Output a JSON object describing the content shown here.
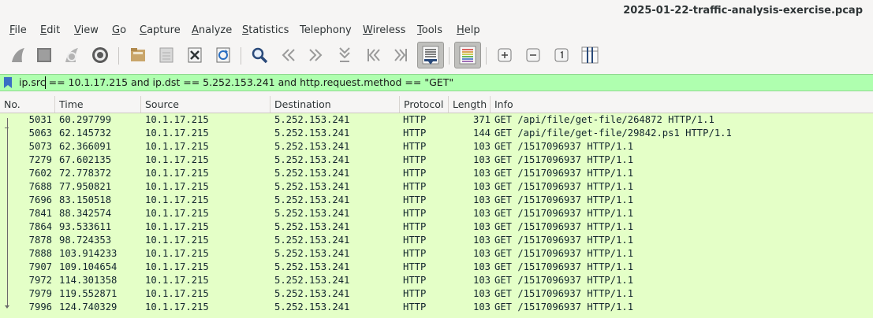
{
  "window": {
    "title": "2025-01-22-traffic-analysis-exercise.pcap"
  },
  "menu": [
    {
      "mn": "F",
      "rest": "ile"
    },
    {
      "mn": "E",
      "rest": "dit"
    },
    {
      "mn": "V",
      "rest": "iew"
    },
    {
      "mn": "G",
      "rest": "o"
    },
    {
      "mn": "C",
      "rest": "apture"
    },
    {
      "mn": "A",
      "rest": "nalyze"
    },
    {
      "mn": "S",
      "rest": "tatistics"
    },
    {
      "mn": "",
      "rest": "Telephony"
    },
    {
      "mn": "W",
      "rest": "ireless"
    },
    {
      "mn": "T",
      "rest": "ools"
    },
    {
      "mn": "H",
      "rest": "elp"
    }
  ],
  "filter": {
    "text": "ip.src == 10.1.17.215 and ip.dst == 5.252.153.241 and http.request.method == \"GET\"",
    "background": "#afffaf"
  },
  "columns": {
    "no": "No.",
    "time": "Time",
    "source": "Source",
    "destination": "Destination",
    "protocol": "Protocol",
    "length": "Length",
    "info": "Info"
  },
  "packets": [
    {
      "no": "5031",
      "time": "60.297799",
      "src": "10.1.17.215",
      "dst": "5.252.153.241",
      "proto": "HTTP",
      "len": "371",
      "info": "GET /api/file/get-file/264872 HTTP/1.1"
    },
    {
      "no": "5063",
      "time": "62.145732",
      "src": "10.1.17.215",
      "dst": "5.252.153.241",
      "proto": "HTTP",
      "len": "144",
      "info": "GET /api/file/get-file/29842.ps1 HTTP/1.1"
    },
    {
      "no": "5073",
      "time": "62.366091",
      "src": "10.1.17.215",
      "dst": "5.252.153.241",
      "proto": "HTTP",
      "len": "103",
      "info": "GET /1517096937 HTTP/1.1"
    },
    {
      "no": "7279",
      "time": "67.602135",
      "src": "10.1.17.215",
      "dst": "5.252.153.241",
      "proto": "HTTP",
      "len": "103",
      "info": "GET /1517096937 HTTP/1.1"
    },
    {
      "no": "7602",
      "time": "72.778372",
      "src": "10.1.17.215",
      "dst": "5.252.153.241",
      "proto": "HTTP",
      "len": "103",
      "info": "GET /1517096937 HTTP/1.1"
    },
    {
      "no": "7688",
      "time": "77.950821",
      "src": "10.1.17.215",
      "dst": "5.252.153.241",
      "proto": "HTTP",
      "len": "103",
      "info": "GET /1517096937 HTTP/1.1"
    },
    {
      "no": "7696",
      "time": "83.150518",
      "src": "10.1.17.215",
      "dst": "5.252.153.241",
      "proto": "HTTP",
      "len": "103",
      "info": "GET /1517096937 HTTP/1.1"
    },
    {
      "no": "7841",
      "time": "88.342574",
      "src": "10.1.17.215",
      "dst": "5.252.153.241",
      "proto": "HTTP",
      "len": "103",
      "info": "GET /1517096937 HTTP/1.1"
    },
    {
      "no": "7864",
      "time": "93.533611",
      "src": "10.1.17.215",
      "dst": "5.252.153.241",
      "proto": "HTTP",
      "len": "103",
      "info": "GET /1517096937 HTTP/1.1"
    },
    {
      "no": "7878",
      "time": "98.724353",
      "src": "10.1.17.215",
      "dst": "5.252.153.241",
      "proto": "HTTP",
      "len": "103",
      "info": "GET /1517096937 HTTP/1.1"
    },
    {
      "no": "7888",
      "time": "103.914233",
      "src": "10.1.17.215",
      "dst": "5.252.153.241",
      "proto": "HTTP",
      "len": "103",
      "info": "GET /1517096937 HTTP/1.1"
    },
    {
      "no": "7907",
      "time": "109.104654",
      "src": "10.1.17.215",
      "dst": "5.252.153.241",
      "proto": "HTTP",
      "len": "103",
      "info": "GET /1517096937 HTTP/1.1"
    },
    {
      "no": "7972",
      "time": "114.301358",
      "src": "10.1.17.215",
      "dst": "5.252.153.241",
      "proto": "HTTP",
      "len": "103",
      "info": "GET /1517096937 HTTP/1.1"
    },
    {
      "no": "7979",
      "time": "119.552871",
      "src": "10.1.17.215",
      "dst": "5.252.153.241",
      "proto": "HTTP",
      "len": "103",
      "info": "GET /1517096937 HTTP/1.1"
    },
    {
      "no": "7996",
      "time": "124.740329",
      "src": "10.1.17.215",
      "dst": "5.252.153.241",
      "proto": "HTTP",
      "len": "103",
      "info": "GET /1517096937 HTTP/1.1"
    }
  ],
  "colors": {
    "row_background": "#e4ffc7",
    "filter_valid": "#afffaf"
  },
  "toolbar_icons": [
    "start-capture-icon",
    "stop-capture-icon",
    "restart-capture-icon",
    "capture-options-icon",
    "open-file-icon",
    "save-file-icon",
    "close-file-icon",
    "reload-file-icon",
    "find-packet-icon",
    "go-back-icon",
    "go-forward-icon",
    "go-to-packet-icon",
    "first-packet-icon",
    "last-packet-icon",
    "auto-scroll-icon",
    "colorize-icon",
    "zoom-in-icon",
    "zoom-out-icon",
    "normal-size-icon",
    "resize-columns-icon"
  ]
}
